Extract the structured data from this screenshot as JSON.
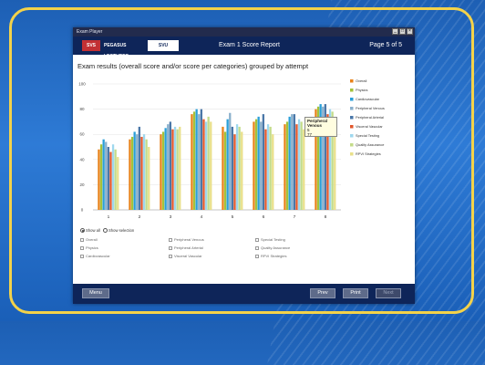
{
  "titlebar": {
    "title": "Exam Player",
    "controls": [
      "_",
      "□",
      "×"
    ]
  },
  "header": {
    "logos": [
      "SVS",
      "PEGASUS LECTURES",
      "SVU"
    ],
    "title": "Exam 1 Score Report",
    "page": "Page 5 of 5"
  },
  "chart_title": "Exam results (overall score and/or score per categories) grouped by attempt",
  "chart_data": {
    "type": "bar",
    "title": "Exam results (overall score and/or score per categories) grouped by attempt",
    "categories": [
      "1",
      "2",
      "3",
      "4",
      "5",
      "6",
      "7",
      "8"
    ],
    "ylim": [
      0,
      100
    ],
    "yticks": [
      "0",
      "20",
      "40",
      "60",
      "80",
      "100"
    ],
    "legend_position": "right",
    "series": [
      {
        "name": "Overall",
        "color": "#e8821a",
        "values": [
          48,
          56,
          60,
          76,
          66,
          70,
          68,
          80
        ]
      },
      {
        "name": "Physics",
        "color": "#a3c23a",
        "values": [
          52,
          58,
          62,
          78,
          62,
          72,
          70,
          82
        ]
      },
      {
        "name": "Cardiovascular",
        "color": "#2a9fd8",
        "values": [
          56,
          62,
          65,
          80,
          72,
          74,
          74,
          84
        ]
      },
      {
        "name": "Peripheral Venous",
        "color": "#8ab0cc",
        "values": [
          54,
          60,
          68,
          76,
          77,
          70,
          76,
          82
        ]
      },
      {
        "name": "Peripheral Arterial",
        "color": "#4a77a8",
        "values": [
          50,
          66,
          70,
          80,
          66,
          76,
          76,
          84
        ]
      },
      {
        "name": "Visceral Vascular",
        "color": "#e0572c",
        "values": [
          46,
          58,
          64,
          72,
          60,
          64,
          68,
          76
        ]
      },
      {
        "name": "Special Testing",
        "color": "#9fd8ee",
        "values": [
          52,
          60,
          66,
          70,
          68,
          68,
          72,
          80
        ]
      },
      {
        "name": "Quality Assurance",
        "color": "#c4dc8a",
        "values": [
          48,
          56,
          64,
          74,
          66,
          66,
          70,
          78
        ]
      },
      {
        "name": "RPVI Strategies",
        "color": "#e9e08a",
        "values": [
          42,
          50,
          66,
          70,
          62,
          60,
          64,
          70
        ]
      }
    ]
  },
  "tooltip": {
    "series": "Peripheral Venous",
    "category": "5",
    "value": "77"
  },
  "view_options": {
    "show_all": "Show all",
    "show_selection": "Show selection",
    "selected": "show_all"
  },
  "filters": [
    [
      "Overall",
      "Peripheral Venous",
      "Special Testing"
    ],
    [
      "Physics",
      "Peripheral Arterial",
      "Quality Assurance"
    ],
    [
      "Cardiovascular",
      "Visceral Vascular",
      "RPVI Strategies"
    ]
  ],
  "footer": {
    "menu": "Menu",
    "prev": "Prev",
    "print": "Print",
    "next": "Next"
  }
}
